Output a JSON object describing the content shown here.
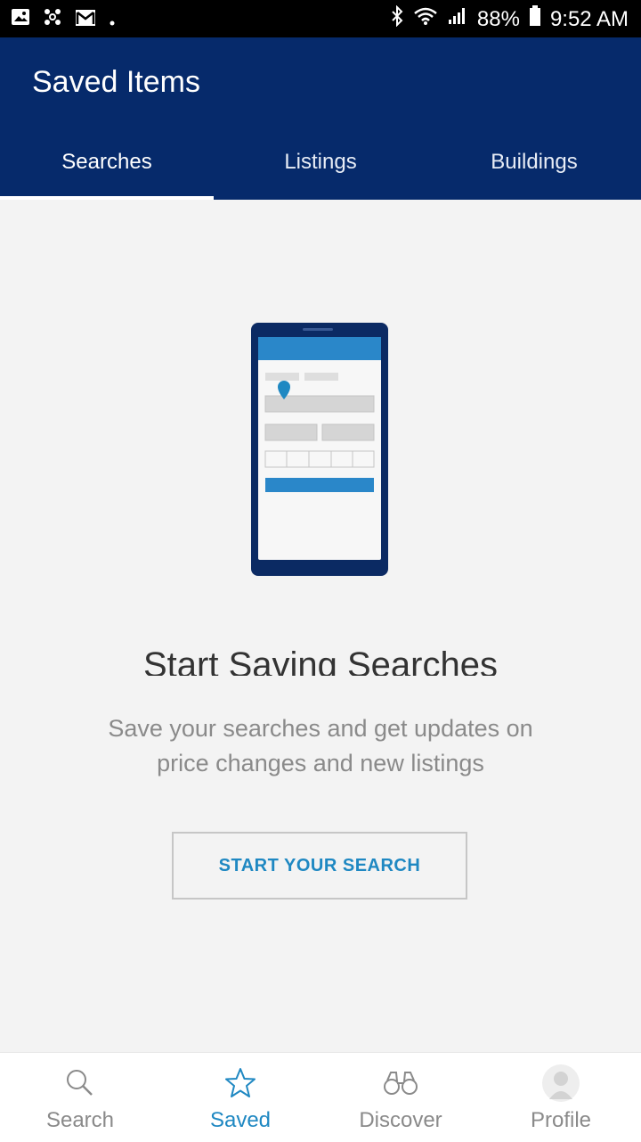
{
  "status_bar": {
    "battery": "88%",
    "time": "9:52 AM",
    "icons_left": [
      "image-icon",
      "pinwheel-icon",
      "gmail-icon",
      "dot-icon"
    ],
    "icons_right": [
      "bluetooth-icon",
      "wifi-icon",
      "signal-icon",
      "battery-icon"
    ]
  },
  "header": {
    "title": "Saved Items",
    "tabs": [
      {
        "label": "Searches",
        "active": true
      },
      {
        "label": "Listings",
        "active": false
      },
      {
        "label": "Buildings",
        "active": false
      }
    ]
  },
  "empty_state": {
    "title": "Start Saving Searches",
    "description": "Save your searches and get updates on price changes and new listings",
    "cta_label": "START YOUR SEARCH"
  },
  "bottom_nav": {
    "items": [
      {
        "label": "Search",
        "icon": "search-icon",
        "active": false
      },
      {
        "label": "Saved",
        "icon": "star-icon",
        "active": true
      },
      {
        "label": "Discover",
        "icon": "binoculars-icon",
        "active": false
      },
      {
        "label": "Profile",
        "icon": "profile-icon",
        "active": false
      }
    ]
  },
  "colors": {
    "header_bg": "#062a6b",
    "accent": "#1f88c2",
    "content_bg": "#f3f3f3"
  }
}
